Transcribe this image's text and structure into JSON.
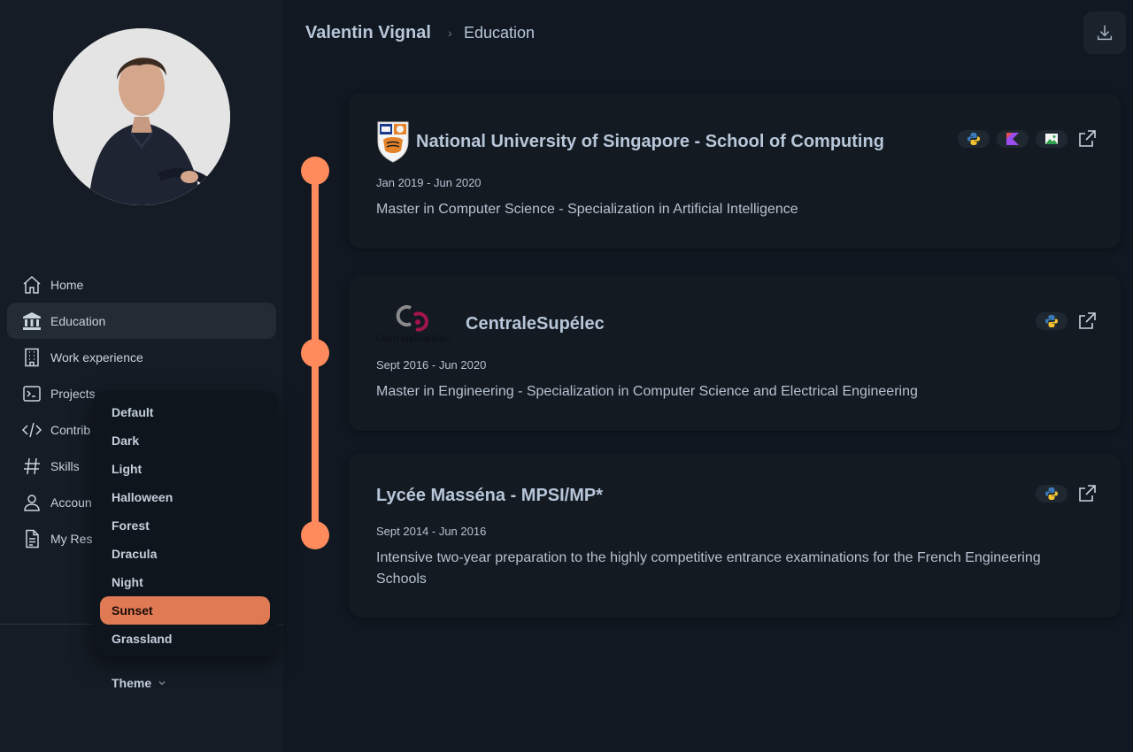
{
  "nav": {
    "items": [
      {
        "label": "Home",
        "icon": "home-icon"
      },
      {
        "label": "Education",
        "icon": "bank-icon",
        "active": true
      },
      {
        "label": "Work experience",
        "icon": "building-icon"
      },
      {
        "label": "Projects",
        "icon": "terminal-icon"
      },
      {
        "label": "Contrib",
        "icon": "code-icon"
      },
      {
        "label": "Skills",
        "icon": "hash-icon"
      },
      {
        "label": "Accoun",
        "icon": "user-icon"
      },
      {
        "label": "My Res",
        "icon": "document-icon"
      }
    ]
  },
  "theme_menu": {
    "options": [
      "Default",
      "Dark",
      "Light",
      "Halloween",
      "Forest",
      "Dracula",
      "Night",
      "Sunset",
      "Grassland"
    ],
    "selected": "Sunset",
    "button_label": "Theme"
  },
  "header": {
    "home": "Valentin Vignal",
    "separator": "›",
    "current": "Education"
  },
  "education": [
    {
      "title": "National University of Singapore - School of Computing",
      "date": "Jan 2019 - Jun 2020",
      "description": "Master in Computer Science - Specialization in Artificial Intelligence",
      "tags": [
        "python-icon",
        "kotlin-icon",
        "android-icon"
      ]
    },
    {
      "title": "CentraleSupélec",
      "logo_text": "CentraleSupélec",
      "date": "Sept 2016 - Jun 2020",
      "description": "Master in Engineering - Specialization in Computer Science and Electrical Engineering",
      "tags": [
        "python-icon"
      ]
    },
    {
      "title": "Lycée Masséna - MPSI/MP*",
      "date": "Sept 2014 - Jun 2016",
      "description": "Intensive two-year preparation to the highly competitive entrance examinations for the French Engineering Schools",
      "tags": [
        "python-icon"
      ]
    }
  ],
  "colors": {
    "accent": "#ff8a5c",
    "selected_theme": "#e07a55",
    "background": "#111821",
    "sidebar": "#151c25"
  }
}
